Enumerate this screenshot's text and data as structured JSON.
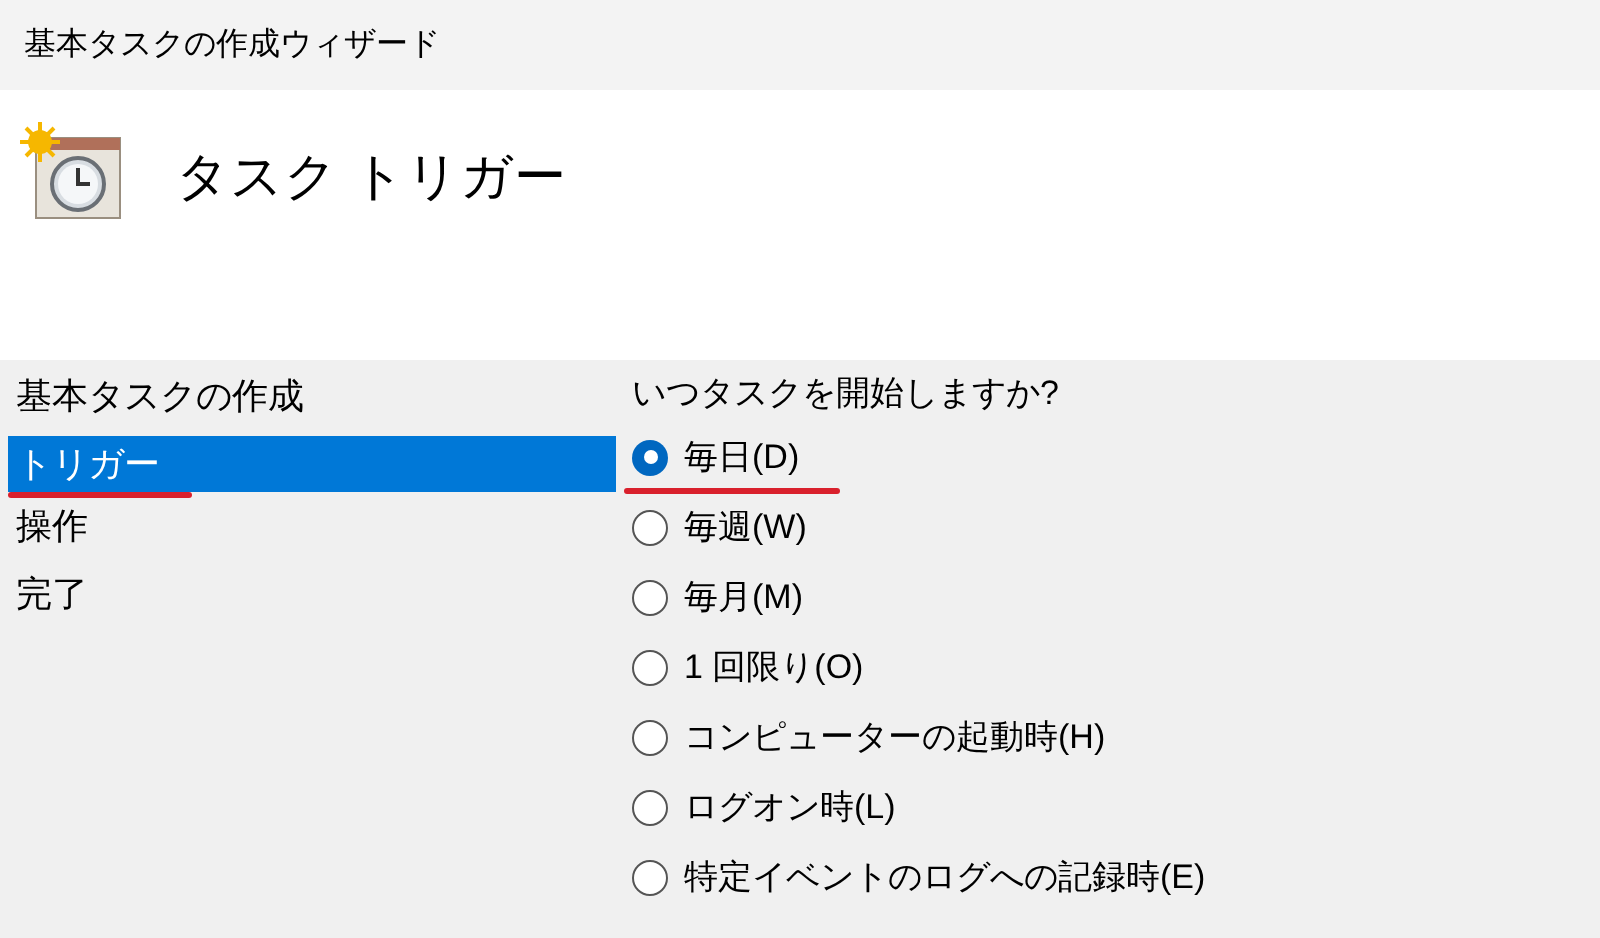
{
  "window": {
    "title": "基本タスクの作成ウィザード"
  },
  "header": {
    "title": "タスク トリガー"
  },
  "steps": [
    {
      "label": "基本タスクの作成",
      "selected": false
    },
    {
      "label": "トリガー",
      "selected": true
    },
    {
      "label": "操作",
      "selected": false
    },
    {
      "label": "完了",
      "selected": false
    }
  ],
  "question": "いつタスクを開始しますか?",
  "options": [
    {
      "label": "毎日(D)",
      "selected": true
    },
    {
      "label": "毎週(W)",
      "selected": false
    },
    {
      "label": "毎月(M)",
      "selected": false
    },
    {
      "label": "1 回限り(O)",
      "selected": false
    },
    {
      "label": "コンピューターの起動時(H)",
      "selected": false
    },
    {
      "label": "ログオン時(L)",
      "selected": false
    },
    {
      "label": "特定イベントのログへの記録時(E)",
      "selected": false
    }
  ]
}
